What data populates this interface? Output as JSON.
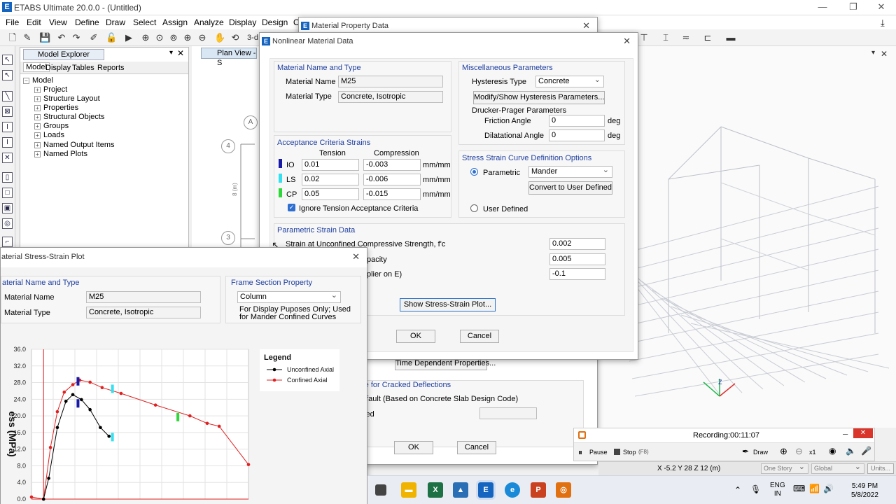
{
  "app": {
    "title": "ETABS Ultimate 20.0.0 - (Untitled)",
    "logo": "E",
    "min": "—",
    "max": "❐",
    "close": "✕"
  },
  "menu": [
    "File",
    "Edit",
    "View",
    "Define",
    "Draw",
    "Select",
    "Assign",
    "Analyze",
    "Display",
    "Design",
    "O"
  ],
  "toolbar": {
    "view3d_label": "3-d"
  },
  "explorer": {
    "header": "Model Explorer",
    "tabs": [
      "Model",
      "Display",
      "Tables",
      "Reports"
    ],
    "root": "Model",
    "items": [
      "Project",
      "Structure Layout",
      "Properties",
      "Structural Objects",
      "Groups",
      "Loads",
      "Named Output Items",
      "Named Plots"
    ]
  },
  "plan_view": {
    "tab_label": "Plan View - S",
    "grid_bubbles": [
      "A",
      "4",
      "3"
    ],
    "dim_label": "8 (m)"
  },
  "material_property_dialog": {
    "title": "Material Property Data",
    "time_dependent_btn": "Time Dependent Properties...",
    "cracked_title": "re for Cracked Deflections",
    "default_text": "efault  (Based on Concrete Slab Design Code)",
    "fied_text": "fied",
    "ok": "OK",
    "cancel": "Cancel"
  },
  "nonlinear_dialog": {
    "title": "Nonlinear Material Data",
    "mat_group_title": "Material Name and Type",
    "mat_name_label": "Material Name",
    "mat_name_value": "M25",
    "mat_type_label": "Material Type",
    "mat_type_value": "Concrete, Isotropic",
    "misc_title": "Miscellaneous Parameters",
    "hysteresis_label": "Hysteresis Type",
    "hysteresis_value": "Concrete",
    "hysteresis_btn": "Modify/Show Hysteresis Parameters...",
    "drucker_label": "Drucker-Prager Parameters",
    "friction_label": "Friction Angle",
    "friction_value": "0",
    "dilatational_label": "Dilatational Angle",
    "dilatational_value": "0",
    "deg": "deg",
    "acceptance_title": "Acceptance Criteria Strains",
    "tension_label": "Tension",
    "compression_label": "Compression",
    "rows": [
      {
        "name": "IO",
        "tension": "0.01",
        "compression": "-0.003",
        "unit": "mm/mm",
        "color": "#1a1aa8"
      },
      {
        "name": "LS",
        "tension": "0.02",
        "compression": "-0.006",
        "unit": "mm/mm",
        "color": "#35e0f0"
      },
      {
        "name": "CP",
        "tension": "0.05",
        "compression": "-0.015",
        "unit": "mm/mm",
        "color": "#2fd83a"
      }
    ],
    "ignore_tension_label": "Ignore Tension Acceptance Criteria",
    "stress_title": "Stress Strain Curve Definition Options",
    "parametric_label": "Parametric",
    "parametric_value": "Mander",
    "convert_btn": "Convert to User Defined",
    "user_defined_label": "User Defined",
    "param_title": "Parametric Strain Data",
    "strain_fc_label": "Strain at Unconfined Compressive Strength, f'c",
    "strain_fc_value": "0.002",
    "capacity_label": "pacity",
    "capacity_value": "0.005",
    "multiplier_label": "plier on E)",
    "multiplier_value": "-0.1",
    "show_plot_btn": "Show Stress-Strain Plot...",
    "ok": "OK",
    "cancel": "Cancel"
  },
  "stress_plot_dialog": {
    "title": "aterial Stress-Strain Plot",
    "mat_group_title": "aterial Name and Type",
    "mat_name_label": "Material Name",
    "mat_name_value": "M25",
    "mat_type_label": "Material Type",
    "mat_type_value": "Concrete, Isotropic",
    "frame_title": "Frame Section Property",
    "frame_value": "Column",
    "display_note": "For Display Puposes Only;  Used for Mander Confined Curves"
  },
  "chart_data": {
    "type": "line",
    "ylabel": "ess (MPa)",
    "yticks": [
      "36.0",
      "32.0",
      "28.0",
      "24.0",
      "20.0",
      "16.0",
      "12.0",
      "8.0",
      "4.0",
      "0.0"
    ],
    "ylim": [
      0,
      36
    ],
    "xlim": [
      -0.0007,
      0.0119
    ],
    "legend_title": "Legend",
    "series": [
      {
        "name": "Unconfined Axial",
        "color": "#000000",
        "x": [
          0,
          0.0003,
          0.0008,
          0.0013,
          0.0017,
          0.0022,
          0.0027,
          0.0033,
          0.0038
        ],
        "y": [
          0,
          5,
          17.2,
          23.5,
          25.1,
          23.9,
          21.5,
          17.2,
          15.1
        ]
      },
      {
        "name": "Confined Axial",
        "color": "#e02020",
        "x": [
          -0.0007,
          0,
          0.0004,
          0.0008,
          0.0012,
          0.0017,
          0.0021,
          0.0027,
          0.0034,
          0.0045,
          0.0065,
          0.0085,
          0.0095,
          0.0102,
          0.0119
        ],
        "y": [
          0.5,
          0,
          12.4,
          21.0,
          25.7,
          27.5,
          28.6,
          28.1,
          26.8,
          25.4,
          22.6,
          20.0,
          18.2,
          17.5,
          8.3
        ]
      }
    ],
    "markers": [
      {
        "x": 0.002,
        "y": 28.3,
        "color": "#1a1aa8"
      },
      {
        "x": 0.002,
        "y": 23.0,
        "color": "#1a1aa8"
      },
      {
        "x": 0.004,
        "y": 26.5,
        "color": "#35e0f0"
      },
      {
        "x": 0.004,
        "y": 14.9,
        "color": "#35e0f0"
      },
      {
        "x": 0.0078,
        "y": 19.7,
        "color": "#2fd83a"
      }
    ]
  },
  "recording": {
    "label": "Recording:",
    "time": "00:11:07",
    "pause": "Pause",
    "stop": "Stop",
    "stop_key": "(F8)",
    "draw": "Draw",
    "zoom": "x1"
  },
  "status": {
    "coords": "X -5.2  Y 28  Z 12 (m)",
    "story": "One Story",
    "global": "Global",
    "units": "Units..."
  },
  "taskbar": {
    "lang1": "ENG",
    "lang2": "IN",
    "time": "5:49 PM",
    "date": "5/8/2022"
  }
}
